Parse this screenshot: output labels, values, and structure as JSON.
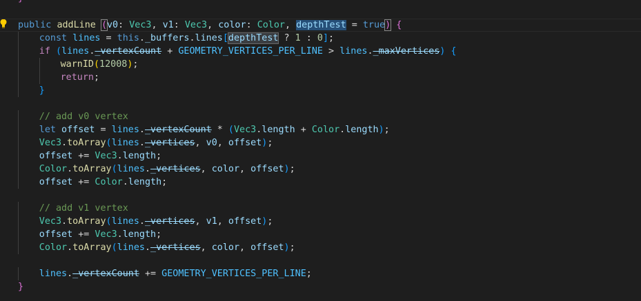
{
  "editor": {
    "top_fragment": "}",
    "lines": [
      {
        "indent": 0,
        "tokens": [
          [
            "public",
            "kw"
          ],
          [
            " ",
            "pun"
          ],
          [
            "addLine",
            "fn"
          ],
          [
            " ",
            "pun"
          ],
          [
            "(",
            "b2 bm"
          ],
          [
            "v0",
            "var"
          ],
          [
            ": ",
            "pun"
          ],
          [
            "Vec3",
            "ty"
          ],
          [
            ", ",
            "pun"
          ],
          [
            "v1",
            "var"
          ],
          [
            ": ",
            "pun"
          ],
          [
            "Vec3",
            "ty"
          ],
          [
            ", ",
            "pun"
          ],
          [
            "color",
            "var"
          ],
          [
            ": ",
            "pun"
          ],
          [
            "Color",
            "ty"
          ],
          [
            ", ",
            "pun"
          ],
          [
            "depthTest",
            "var hl"
          ],
          [
            " = ",
            "pun"
          ],
          [
            "true",
            "kw"
          ],
          [
            ")",
            "b2 bm"
          ],
          [
            " ",
            "pun"
          ],
          [
            "{",
            "b2"
          ]
        ]
      },
      {
        "indent": 1,
        "tokens": [
          [
            "const",
            "kw"
          ],
          [
            " ",
            "pun"
          ],
          [
            "lines",
            "cst"
          ],
          [
            " = ",
            "pun"
          ],
          [
            "this",
            "kw"
          ],
          [
            ".",
            "pun"
          ],
          [
            "_buffers",
            "var"
          ],
          [
            ".",
            "pun"
          ],
          [
            "lines",
            "var"
          ],
          [
            "[",
            "b3"
          ],
          [
            "depthTest",
            "var hlb"
          ],
          [
            " ? ",
            "pun"
          ],
          [
            "1",
            "num"
          ],
          [
            " : ",
            "pun"
          ],
          [
            "0",
            "num"
          ],
          [
            "]",
            "b3"
          ],
          [
            ";",
            "pun"
          ]
        ]
      },
      {
        "indent": 1,
        "tokens": [
          [
            "if",
            "ctl"
          ],
          [
            " ",
            "pun"
          ],
          [
            "(",
            "b3"
          ],
          [
            "lines",
            "cst"
          ],
          [
            ".",
            "pun"
          ],
          [
            "_vertexCount",
            "var dep"
          ],
          [
            " + ",
            "pun"
          ],
          [
            "GEOMETRY_VERTICES_PER_LINE",
            "cst"
          ],
          [
            " > ",
            "pun"
          ],
          [
            "lines",
            "cst"
          ],
          [
            ".",
            "pun"
          ],
          [
            "_maxVertices",
            "var dep"
          ],
          [
            ")",
            "b3"
          ],
          [
            " ",
            "pun"
          ],
          [
            "{",
            "b3"
          ]
        ]
      },
      {
        "indent": 2,
        "tokens": [
          [
            "warnID",
            "fn"
          ],
          [
            "(",
            "b1"
          ],
          [
            "12008",
            "num"
          ],
          [
            ")",
            "b1"
          ],
          [
            ";",
            "pun"
          ]
        ]
      },
      {
        "indent": 2,
        "tokens": [
          [
            "return",
            "ctl"
          ],
          [
            ";",
            "pun"
          ]
        ]
      },
      {
        "indent": 1,
        "tokens": [
          [
            "}",
            "b3"
          ]
        ]
      },
      {
        "indent": 0,
        "tokens": []
      },
      {
        "indent": 1,
        "tokens": [
          [
            "// add v0 vertex",
            "cmt"
          ]
        ]
      },
      {
        "indent": 1,
        "tokens": [
          [
            "let",
            "kw"
          ],
          [
            " ",
            "pun"
          ],
          [
            "offset",
            "var"
          ],
          [
            " = ",
            "pun"
          ],
          [
            "lines",
            "cst"
          ],
          [
            ".",
            "pun"
          ],
          [
            "_vertexCount",
            "var dep"
          ],
          [
            " * ",
            "pun"
          ],
          [
            "(",
            "b3"
          ],
          [
            "Vec3",
            "ty"
          ],
          [
            ".",
            "pun"
          ],
          [
            "length",
            "var"
          ],
          [
            " + ",
            "pun"
          ],
          [
            "Color",
            "ty"
          ],
          [
            ".",
            "pun"
          ],
          [
            "length",
            "var"
          ],
          [
            ")",
            "b3"
          ],
          [
            ";",
            "pun"
          ]
        ]
      },
      {
        "indent": 1,
        "tokens": [
          [
            "Vec3",
            "ty"
          ],
          [
            ".",
            "pun"
          ],
          [
            "toArray",
            "fn"
          ],
          [
            "(",
            "b3"
          ],
          [
            "lines",
            "cst"
          ],
          [
            ".",
            "pun"
          ],
          [
            "_vertices",
            "var dep"
          ],
          [
            ", ",
            "pun"
          ],
          [
            "v0",
            "var"
          ],
          [
            ", ",
            "pun"
          ],
          [
            "offset",
            "var"
          ],
          [
            ")",
            "b3"
          ],
          [
            ";",
            "pun"
          ]
        ]
      },
      {
        "indent": 1,
        "tokens": [
          [
            "offset",
            "var"
          ],
          [
            " += ",
            "pun"
          ],
          [
            "Vec3",
            "ty"
          ],
          [
            ".",
            "pun"
          ],
          [
            "length",
            "var"
          ],
          [
            ";",
            "pun"
          ]
        ]
      },
      {
        "indent": 1,
        "tokens": [
          [
            "Color",
            "ty"
          ],
          [
            ".",
            "pun"
          ],
          [
            "toArray",
            "fn"
          ],
          [
            "(",
            "b3"
          ],
          [
            "lines",
            "cst"
          ],
          [
            ".",
            "pun"
          ],
          [
            "_vertices",
            "var dep"
          ],
          [
            ", ",
            "pun"
          ],
          [
            "color",
            "var"
          ],
          [
            ", ",
            "pun"
          ],
          [
            "offset",
            "var"
          ],
          [
            ")",
            "b3"
          ],
          [
            ";",
            "pun"
          ]
        ]
      },
      {
        "indent": 1,
        "tokens": [
          [
            "offset",
            "var"
          ],
          [
            " += ",
            "pun"
          ],
          [
            "Color",
            "ty"
          ],
          [
            ".",
            "pun"
          ],
          [
            "length",
            "var"
          ],
          [
            ";",
            "pun"
          ]
        ]
      },
      {
        "indent": 0,
        "tokens": []
      },
      {
        "indent": 1,
        "tokens": [
          [
            "// add v1 vertex",
            "cmt"
          ]
        ]
      },
      {
        "indent": 1,
        "tokens": [
          [
            "Vec3",
            "ty"
          ],
          [
            ".",
            "pun"
          ],
          [
            "toArray",
            "fn"
          ],
          [
            "(",
            "b3"
          ],
          [
            "lines",
            "cst"
          ],
          [
            ".",
            "pun"
          ],
          [
            "_vertices",
            "var dep"
          ],
          [
            ", ",
            "pun"
          ],
          [
            "v1",
            "var"
          ],
          [
            ", ",
            "pun"
          ],
          [
            "offset",
            "var"
          ],
          [
            ")",
            "b3"
          ],
          [
            ";",
            "pun"
          ]
        ]
      },
      {
        "indent": 1,
        "tokens": [
          [
            "offset",
            "var"
          ],
          [
            " += ",
            "pun"
          ],
          [
            "Vec3",
            "ty"
          ],
          [
            ".",
            "pun"
          ],
          [
            "length",
            "var"
          ],
          [
            ";",
            "pun"
          ]
        ]
      },
      {
        "indent": 1,
        "tokens": [
          [
            "Color",
            "ty"
          ],
          [
            ".",
            "pun"
          ],
          [
            "toArray",
            "fn"
          ],
          [
            "(",
            "b3"
          ],
          [
            "lines",
            "cst"
          ],
          [
            ".",
            "pun"
          ],
          [
            "_vertices",
            "var dep"
          ],
          [
            ", ",
            "pun"
          ],
          [
            "color",
            "var"
          ],
          [
            ", ",
            "pun"
          ],
          [
            "offset",
            "var"
          ],
          [
            ")",
            "b3"
          ],
          [
            ";",
            "pun"
          ]
        ]
      },
      {
        "indent": 0,
        "tokens": []
      },
      {
        "indent": 1,
        "tokens": [
          [
            "lines",
            "cst"
          ],
          [
            ".",
            "pun"
          ],
          [
            "_vertexCount",
            "var dep"
          ],
          [
            " += ",
            "pun"
          ],
          [
            "GEOMETRY_VERTICES_PER_LINE",
            "cst"
          ],
          [
            ";",
            "pun"
          ]
        ]
      },
      {
        "indent": 0,
        "tokens": [
          [
            "}",
            "b2"
          ]
        ]
      }
    ],
    "current_line_index": 0,
    "lightbulb_icon": "lightbulb-icon",
    "colors": {
      "background": "#1e1e1e",
      "keyword": "#569cd6",
      "control": "#c586c0",
      "function": "#dcdcaa",
      "variable": "#9cdcfe",
      "type": "#4ec9b0",
      "constant": "#4fc1ff",
      "number": "#b5cea8",
      "comment": "#6a9955",
      "bracket_level1": "#ffd700",
      "bracket_level2": "#da70d6",
      "bracket_level3": "#179fff",
      "lightbulb": "#ffcc00"
    }
  }
}
